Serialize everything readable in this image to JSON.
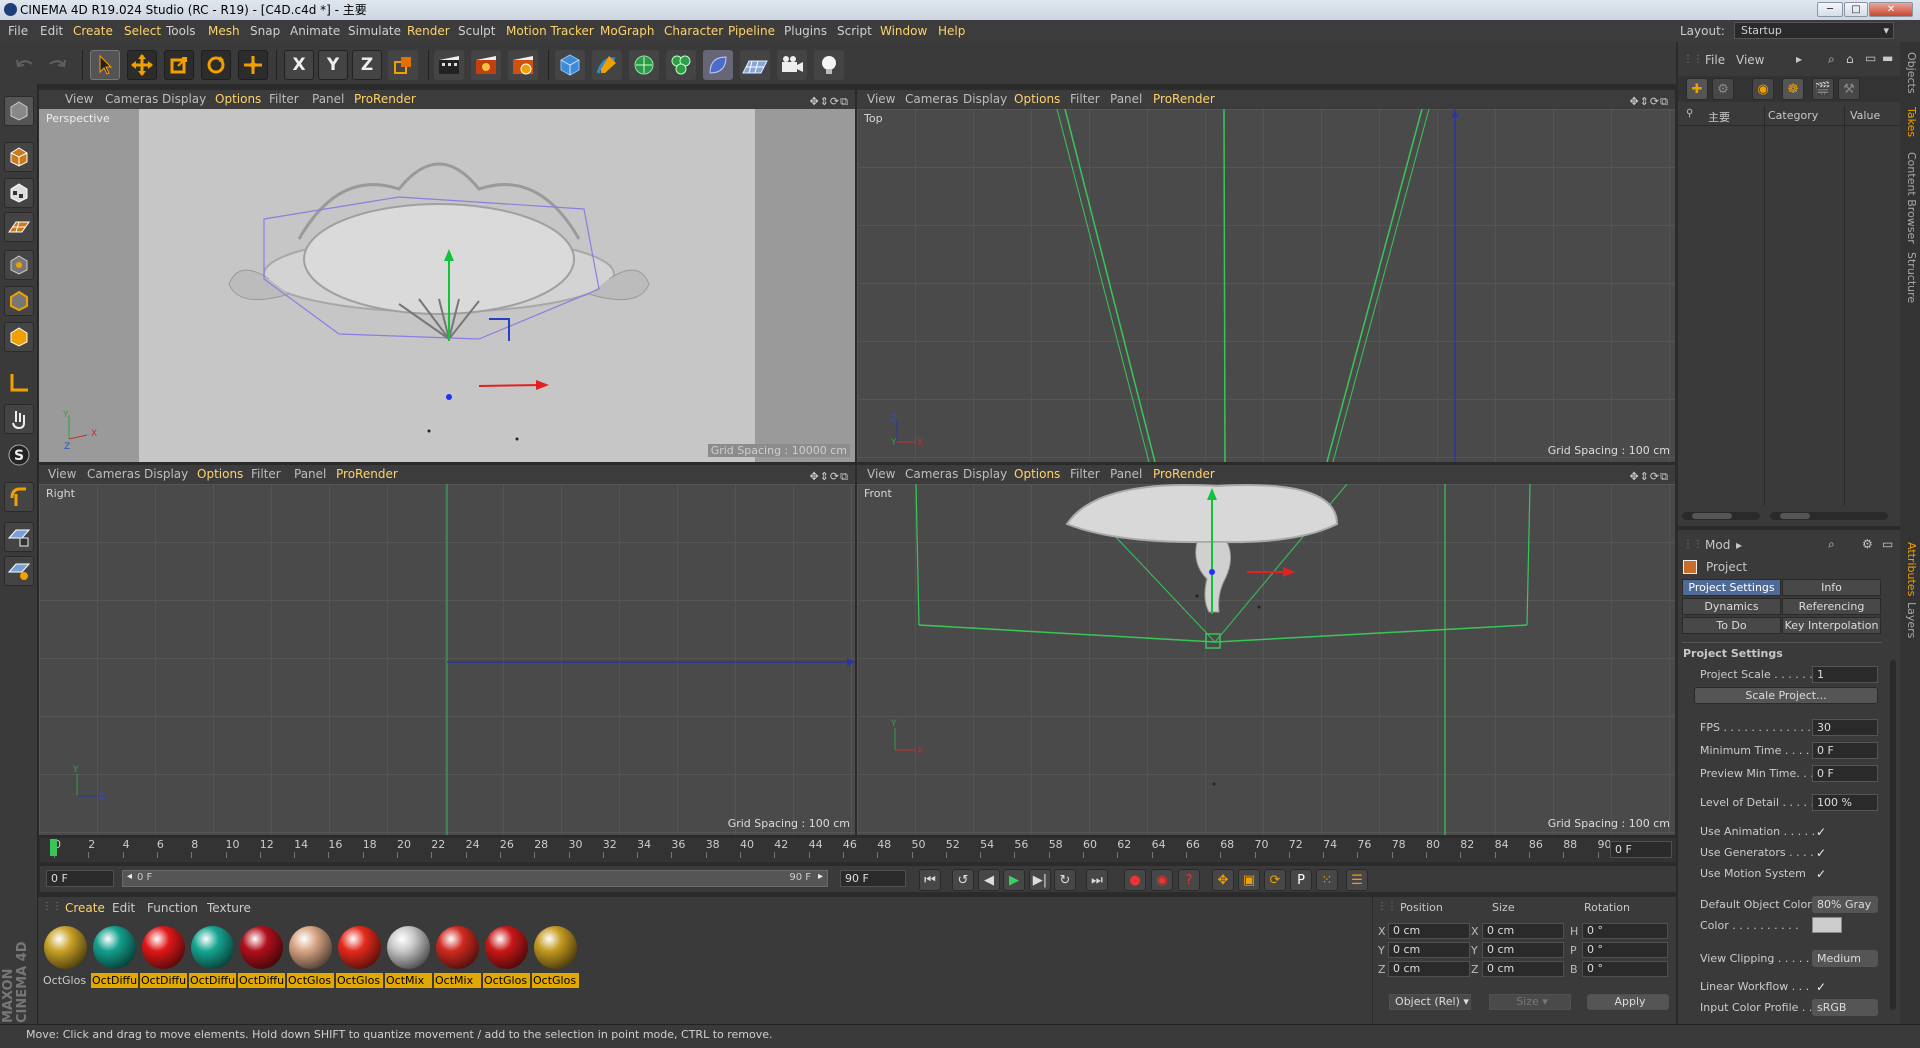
{
  "window": {
    "title": "CINEMA 4D R19.024 Studio (RC - R19) - [C4D.c4d *] - 主要"
  },
  "menu": [
    "File",
    "Edit",
    "Create",
    "Select",
    "Tools",
    "Mesh",
    "Snap",
    "Animate",
    "Simulate",
    "Render",
    "Sculpt",
    "Motion Tracker",
    "MoGraph",
    "Character",
    "Pipeline",
    "Plugins",
    "Script",
    "Window",
    "Help"
  ],
  "layout": {
    "label": "Layout:",
    "value": "Startup"
  },
  "viewport_menu": [
    "View",
    "Cameras",
    "Display",
    "Options",
    "Filter",
    "Panel",
    "ProRender"
  ],
  "viewports": {
    "perspective": {
      "name": "Perspective",
      "grid": "Grid Spacing : 10000 cm"
    },
    "top": {
      "name": "Top",
      "grid": "Grid Spacing : 100 cm"
    },
    "right": {
      "name": "Right",
      "grid": "Grid Spacing : 100 cm"
    },
    "front": {
      "name": "Front",
      "grid": "Grid Spacing : 100 cm"
    }
  },
  "axis": {
    "x": "X",
    "y": "Y",
    "z": "Z"
  },
  "timeline": {
    "ticks": [
      "0",
      "2",
      "4",
      "6",
      "8",
      "10",
      "12",
      "14",
      "16",
      "18",
      "20",
      "22",
      "24",
      "26",
      "28",
      "30",
      "32",
      "34",
      "36",
      "38",
      "40",
      "42",
      "44",
      "46",
      "48",
      "50",
      "52",
      "54",
      "56",
      "58",
      "60",
      "62",
      "64",
      "66",
      "68",
      "70",
      "72",
      "74",
      "76",
      "78",
      "80",
      "82",
      "84",
      "86",
      "88",
      "90"
    ],
    "current_frame": "0 F",
    "start_frame": "0 F",
    "range_start": "0 F",
    "range_end": "90 F",
    "end_frame": "90 F"
  },
  "materials": {
    "menu": [
      "Create",
      "Edit",
      "Function",
      "Texture"
    ],
    "items": [
      {
        "label": "OctGlos",
        "color": "#c9a227"
      },
      {
        "label": "OctDiffu",
        "color": "#13a08e"
      },
      {
        "label": "OctDiffu",
        "color": "#e01818"
      },
      {
        "label": "OctDiffu",
        "color": "#17a692"
      },
      {
        "label": "OctDiffu",
        "color": "#b0101c"
      },
      {
        "label": "OctGlos",
        "color": "#d8a585"
      },
      {
        "label": "OctGlos",
        "color": "#e52a1c"
      },
      {
        "label": "OctMix",
        "color": "#c8c8c8"
      },
      {
        "label": "OctMix",
        "color": "#d02a20"
      },
      {
        "label": "OctGlos",
        "color": "#c81818"
      },
      {
        "label": "OctGlos",
        "color": "#c49a20"
      }
    ]
  },
  "coords": {
    "headers": [
      "Position",
      "Size",
      "Rotation"
    ],
    "rows": [
      {
        "a": "X",
        "pos": "0 cm",
        "b": "X",
        "size": "0 cm",
        "c": "H",
        "rot": "0 °"
      },
      {
        "a": "Y",
        "pos": "0 cm",
        "b": "Y",
        "size": "0 cm",
        "c": "P",
        "rot": "0 °"
      },
      {
        "a": "Z",
        "pos": "0 cm",
        "b": "Z",
        "size": "0 cm",
        "c": "B",
        "rot": "0 °"
      }
    ],
    "mode": "Object (Rel)",
    "size_mode": "Size",
    "apply": "Apply"
  },
  "status": "Move: Click and drag to move elements. Hold down SHIFT to quantize movement / add to the selection in point mode, CTRL to remove.",
  "brand": "MAXON CINEMA 4D",
  "objects": {
    "menu": [
      "File",
      "View"
    ],
    "item": "主要",
    "cols": [
      "Category",
      "Value"
    ]
  },
  "attributes": {
    "mode": "Mod",
    "title": "Project",
    "tabs": [
      "Project Settings",
      "Info",
      "Dynamics",
      "Referencing",
      "To Do",
      "Key Interpolation"
    ],
    "section": "Project Settings",
    "project_scale": {
      "label": "Project Scale . . . . . .",
      "value": "1"
    },
    "scale_button": "Scale Project...",
    "fps": {
      "label": "FPS . . . . . . . . . . . . . . .",
      "value": "30"
    },
    "min_time": {
      "label": "Minimum Time . . . . .",
      "value": "0 F"
    },
    "preview_min": {
      "label": "Preview Min Time. . .",
      "value": "0 F"
    },
    "lod": {
      "label": "Level of Detail . . . . .",
      "value": "100 %"
    },
    "use_animation": "Use Animation . . . . .",
    "use_generators": "Use Generators . . . .",
    "use_motion": "Use Motion System",
    "default_color": {
      "label": "Default Object Color",
      "value": "80% Gray"
    },
    "color": "Color . . . . . . . . . .",
    "view_clipping": {
      "label": "View Clipping . . . . .",
      "value": "Medium"
    },
    "linear_workflow": "Linear Workflow . . .",
    "input_profile": {
      "label": "Input Color Profile . .",
      "value": "sRGB"
    }
  },
  "side_tabs": [
    "Objects",
    "Takes",
    "Content Browser",
    "Structure",
    "Attributes",
    "Layers"
  ]
}
